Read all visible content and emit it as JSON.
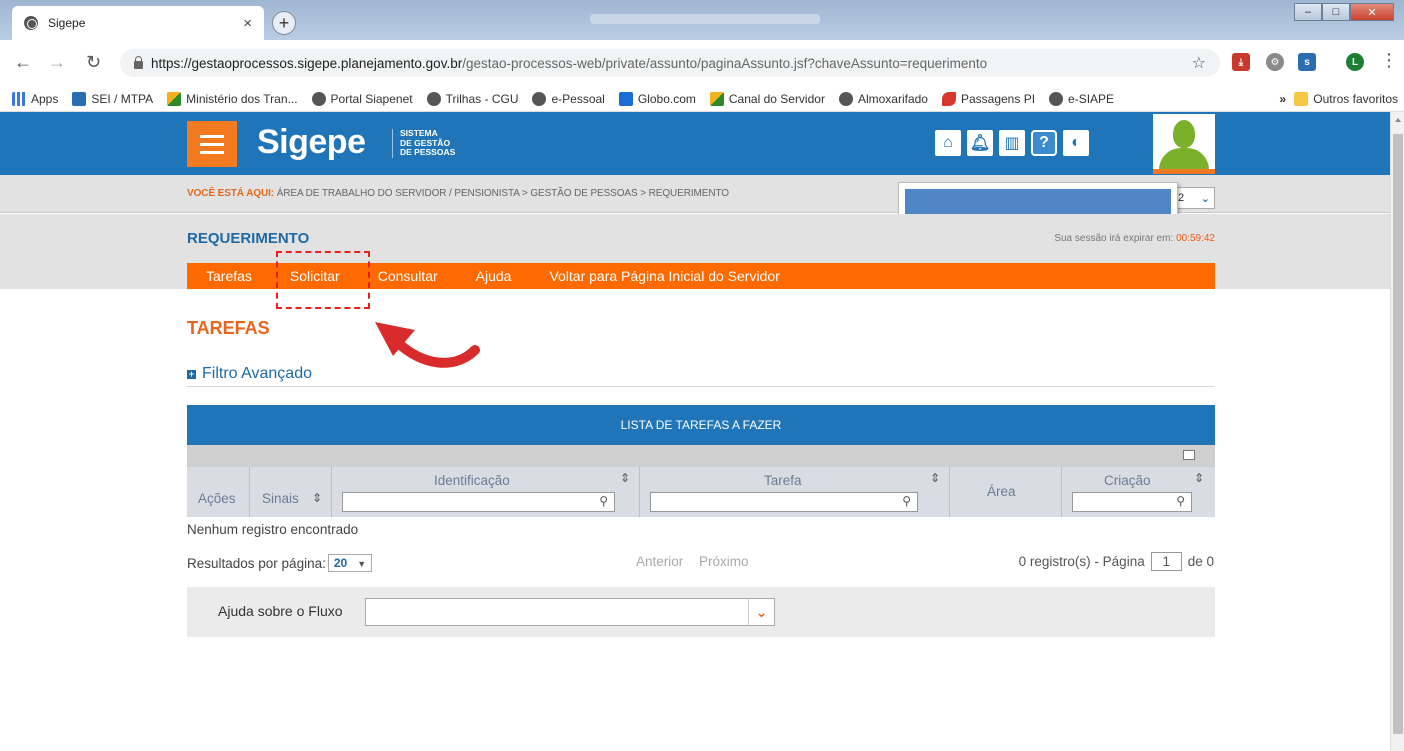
{
  "browser": {
    "tab_title": "Sigepe",
    "url_host": "https://gestaoprocessos.sigepe.planejamento.gov.br",
    "url_path": "/gestao-processos-web/private/assunto/paginaAssunto.jsf?chaveAssunto=requerimento",
    "bookmarks": [
      "Apps",
      "SEI / MTPA",
      "Ministério dos Tran...",
      "Portal Siapenet",
      "Trilhas - CGU",
      "e-Pessoal",
      "Globo.com",
      "Canal do Servidor",
      "Almoxarifado",
      "Passagens PI",
      "e-SIAPE"
    ],
    "bookmarks_more": "»",
    "other_bookmarks": "Outros favoritos"
  },
  "header": {
    "logo": "Sigepe",
    "logo_sub": [
      "SISTEMA",
      "DE GESTÃO",
      "DE PESSOAS"
    ]
  },
  "breadcrumb": {
    "label": "VOCÊ ESTÁ AQUI:",
    "path": "ÁREA DE TRABALHO DO SERVIDOR / PENSIONISTA > GESTÃO DE PESSOAS > REQUERIMENTO",
    "dropdown_value": "2"
  },
  "page": {
    "title": "REQUERIMENTO",
    "session_text": "Sua sessão irá expirar em:",
    "session_time": "00:59:42"
  },
  "menu": [
    "Tarefas",
    "Solicitar",
    "Consultar",
    "Ajuda",
    "Voltar para Página Inicial do Servidor"
  ],
  "tasks": {
    "title": "TAREFAS",
    "filter": "Filtro Avançado",
    "grid_title": "LISTA DE TAREFAS A FAZER",
    "columns": {
      "acoes": "Ações",
      "sinais": "Sinais",
      "identificacao": "Identificação",
      "tarefa": "Tarefa",
      "area": "Área",
      "criacao": "Criação"
    },
    "empty": "Nenhum registro encontrado",
    "per_page_label": "Resultados por página:",
    "per_page_value": "20",
    "prev": "Anterior",
    "next": "Próximo",
    "records": "0 registro(s) - Página",
    "page_value": "1",
    "of_label": "de 0"
  },
  "help_flow": {
    "label": "Ajuda sobre o Fluxo",
    "value": ""
  }
}
